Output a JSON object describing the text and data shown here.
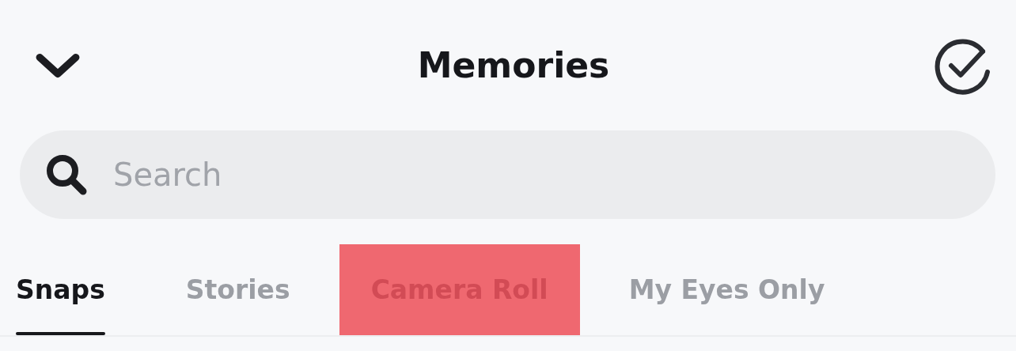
{
  "header": {
    "title": "Memories"
  },
  "search": {
    "placeholder": "Search"
  },
  "tabs": [
    {
      "label": "Snaps",
      "selected": true,
      "highlighted": false
    },
    {
      "label": "Stories",
      "selected": false,
      "highlighted": false
    },
    {
      "label": "Camera Roll",
      "selected": false,
      "highlighted": true
    },
    {
      "label": "My Eyes Only",
      "selected": false,
      "highlighted": false
    }
  ]
}
